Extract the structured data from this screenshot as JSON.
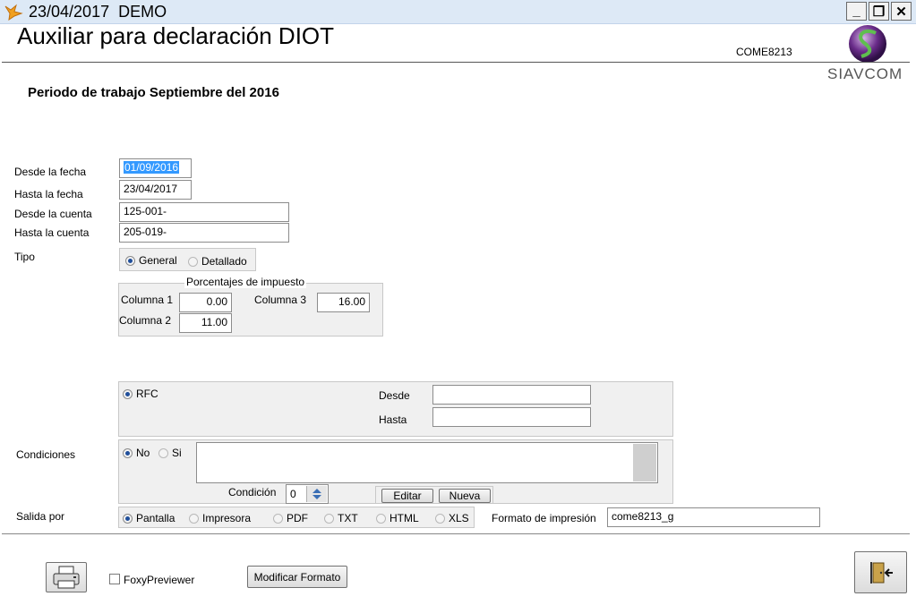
{
  "window": {
    "title": "23/04/2017  DEMO",
    "minimize": "_",
    "restore": "❐",
    "close": "✕"
  },
  "header": {
    "title": "Auxiliar para declaración DIOT",
    "code": "COME8213",
    "logo_text": "SIAVCOM"
  },
  "periodo": "Periodo de trabajo Septiembre del 2016",
  "form": {
    "desde_fecha_label": "Desde la fecha",
    "desde_fecha_value": "01/09/2016",
    "hasta_fecha_label": "Hasta la fecha",
    "hasta_fecha_value": "23/04/2017",
    "desde_cuenta_label": "Desde la cuenta",
    "desde_cuenta_value": "125-001-",
    "hasta_cuenta_label": "Hasta la cuenta",
    "hasta_cuenta_value": "205-019-",
    "tipo_label": "Tipo",
    "tipo_general": "General",
    "tipo_detallado": "Detallado"
  },
  "porcentajes": {
    "title": "Porcentajes de impuesto",
    "col1_label": "Columna 1",
    "col1_value": "0.00",
    "col2_label": "Columna 2",
    "col2_value": "11.00",
    "col3_label": "Columna 3",
    "col3_value": "16.00"
  },
  "rfc": {
    "label": "RFC",
    "desde_label": "Desde",
    "desde_value": "",
    "hasta_label": "Hasta",
    "hasta_value": ""
  },
  "condiciones": {
    "label": "Condiciones",
    "no": "No",
    "si": "Si",
    "condicion_label": "Condición",
    "condicion_value": "0",
    "editar": "Editar",
    "nueva": "Nueva"
  },
  "salida": {
    "label": "Salida por",
    "options": [
      "Pantalla",
      "Impresora",
      "PDF",
      "TXT",
      "HTML",
      "XLS"
    ],
    "selected": "Pantalla",
    "formato_label": "Formato de impresión",
    "formato_value": "come8213_g"
  },
  "footer": {
    "foxy_label": "FoxyPreviewer",
    "modificar": "Modificar Formato"
  },
  "colors": {
    "titlebar": "#dde9f6",
    "panel": "#f0f0f0",
    "selection": "#3399ff",
    "radio_dot": "#1f4e9a"
  }
}
